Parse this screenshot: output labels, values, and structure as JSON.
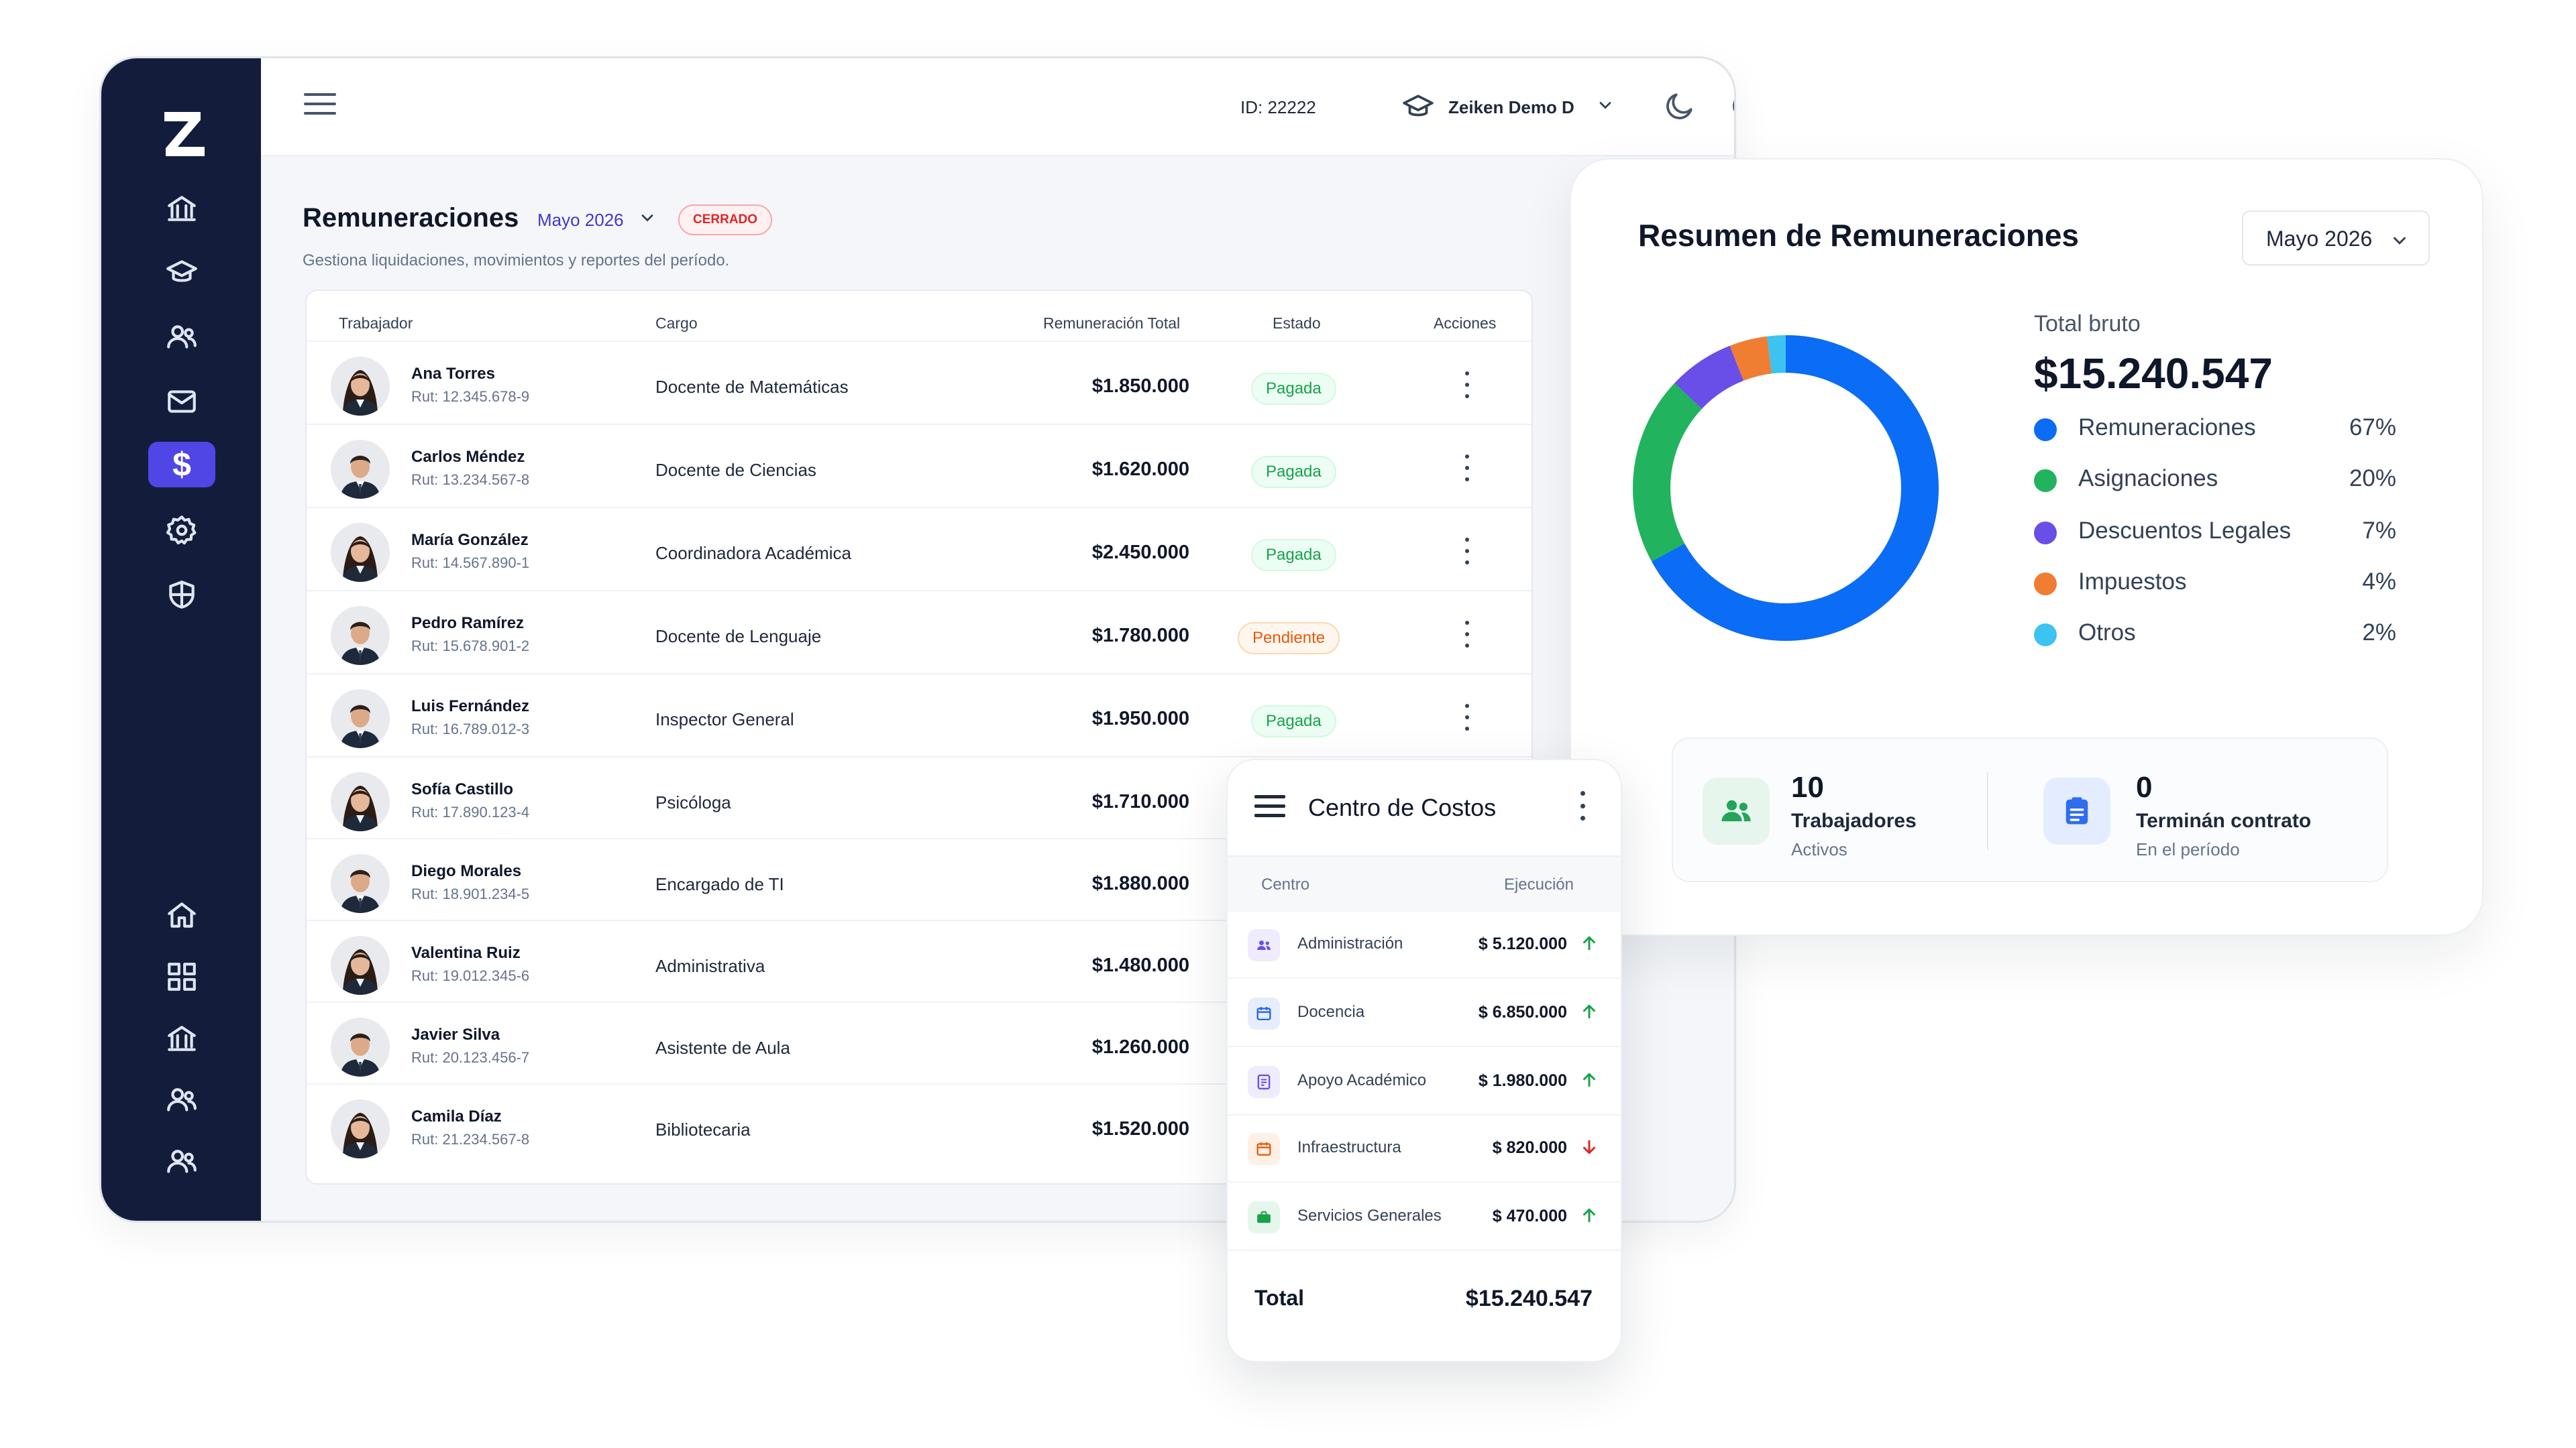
{
  "topbar": {
    "id_text": "ID:  22222",
    "organization": "Zeiken Demo D"
  },
  "page": {
    "title": "Remuneraciones",
    "period": "Mayo 2026",
    "status_badge": "CERRADO",
    "subtitle": "Gestiona liquidaciones, movimientos y reportes del período."
  },
  "table": {
    "headers": {
      "worker": "Trabajador",
      "role": "Cargo",
      "total": "Remuneración Total",
      "status": "Estado",
      "actions": "Acciones"
    },
    "rows": [
      {
        "name": "Ana Torres",
        "rut": "Rut: 12.345.678-9",
        "role": "Docente de Matemáticas",
        "amount": "$1.850.000",
        "status": "Pagada",
        "gender": "f"
      },
      {
        "name": "Carlos Méndez",
        "rut": "Rut: 13.234.567-8",
        "role": "Docente de Ciencias",
        "amount": "$1.620.000",
        "status": "Pagada",
        "gender": "m"
      },
      {
        "name": "María González",
        "rut": "Rut: 14.567.890-1",
        "role": "Coordinadora Académica",
        "amount": "$2.450.000",
        "status": "Pagada",
        "gender": "f"
      },
      {
        "name": "Pedro Ramírez",
        "rut": "Rut: 15.678.901-2",
        "role": "Docente de Lenguaje",
        "amount": "$1.780.000",
        "status": "Pendiente",
        "gender": "m"
      },
      {
        "name": "Luis Fernández",
        "rut": "Rut: 16.789.012-3",
        "role": "Inspector General",
        "amount": "$1.950.000",
        "status": "Pagada",
        "gender": "m"
      },
      {
        "name": "Sofía Castillo",
        "rut": "Rut: 17.890.123-4",
        "role": "Psicóloga",
        "amount": "$1.710.000",
        "status": "",
        "gender": "f"
      },
      {
        "name": "Diego Morales",
        "rut": "Rut: 18.901.234-5",
        "role": "Encargado de TI",
        "amount": "$1.880.000",
        "status": "",
        "gender": "m"
      },
      {
        "name": "Valentina Ruiz",
        "rut": "Rut: 19.012.345-6",
        "role": "Administrativa",
        "amount": "$1.480.000",
        "status": "",
        "gender": "f"
      },
      {
        "name": "Javier Silva",
        "rut": "Rut: 20.123.456-7",
        "role": "Asistente de Aula",
        "amount": "$1.260.000",
        "status": "",
        "gender": "m"
      },
      {
        "name": "Camila Díaz",
        "rut": "Rut: 21.234.567-8",
        "role": "Bibliotecaria",
        "amount": "$1.520.000",
        "status": "",
        "gender": "f"
      }
    ]
  },
  "summary": {
    "title": "Resumen de Remuneraciones",
    "period_select": "Mayo 2026",
    "total_label": "Total bruto",
    "total_value": "$15.240.547",
    "legend": [
      {
        "name": "Remuneraciones",
        "pct": "67%",
        "value": 67,
        "color": "#0b6cf5"
      },
      {
        "name": "Asignaciones",
        "pct": "20%",
        "value": 20,
        "color": "#22b35e"
      },
      {
        "name": "Descuentos Legales",
        "pct": "7%",
        "value": 7,
        "color": "#6a4ee8"
      },
      {
        "name": "Impuestos",
        "pct": "4%",
        "value": 4,
        "color": "#ef7d32"
      },
      {
        "name": "Otros",
        "pct": "2%",
        "value": 2,
        "color": "#3cc3f0"
      }
    ],
    "stats": [
      {
        "number": "10",
        "label": "Trabajadores",
        "sub": "Activos"
      },
      {
        "number": "0",
        "label": "Terminán contrato",
        "sub": "En el período"
      }
    ]
  },
  "costos": {
    "title": "Centro de Costos",
    "col_center": "Centro",
    "col_execution": "Ejecución",
    "rows": [
      {
        "name": "Administración",
        "amount": "$ 5.120.000",
        "trend": "up",
        "icon": "people-icon",
        "color": "#6a4ee8"
      },
      {
        "name": "Docencia",
        "amount": "$ 6.850.000",
        "trend": "up",
        "icon": "calendar-icon",
        "color": "#2563eb"
      },
      {
        "name": "Apoyo Académico",
        "amount": "$ 1.980.000",
        "trend": "up",
        "icon": "document-icon",
        "color": "#6a4ee8"
      },
      {
        "name": "Infraestructura",
        "amount": "$ 820.000",
        "trend": "down",
        "icon": "calendar-icon",
        "color": "#ea580c"
      },
      {
        "name": "Servicios Generales",
        "amount": "$ 470.000",
        "trend": "up",
        "icon": "briefcase-icon",
        "color": "#16a34a"
      }
    ],
    "total_label": "Total",
    "total_value": "$15.240.547"
  }
}
